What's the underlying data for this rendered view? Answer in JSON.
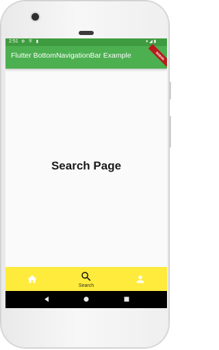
{
  "status_bar": {
    "time": "2:51"
  },
  "app_bar": {
    "title": "Flutter BottomNavigationBar Example",
    "debug_banner": "DEBUG"
  },
  "page": {
    "heading": "Search Page"
  },
  "bottom_nav": {
    "items": [
      {
        "label": "",
        "icon": "home-icon",
        "selected": false
      },
      {
        "label": "Search",
        "icon": "search-icon",
        "selected": true
      },
      {
        "label": "",
        "icon": "person-icon",
        "selected": false
      }
    ]
  },
  "colors": {
    "app_bar": "#4caf50",
    "status_bar": "#3e9b3f",
    "bottom_nav": "#ffeb3b",
    "background": "#fafafa"
  }
}
